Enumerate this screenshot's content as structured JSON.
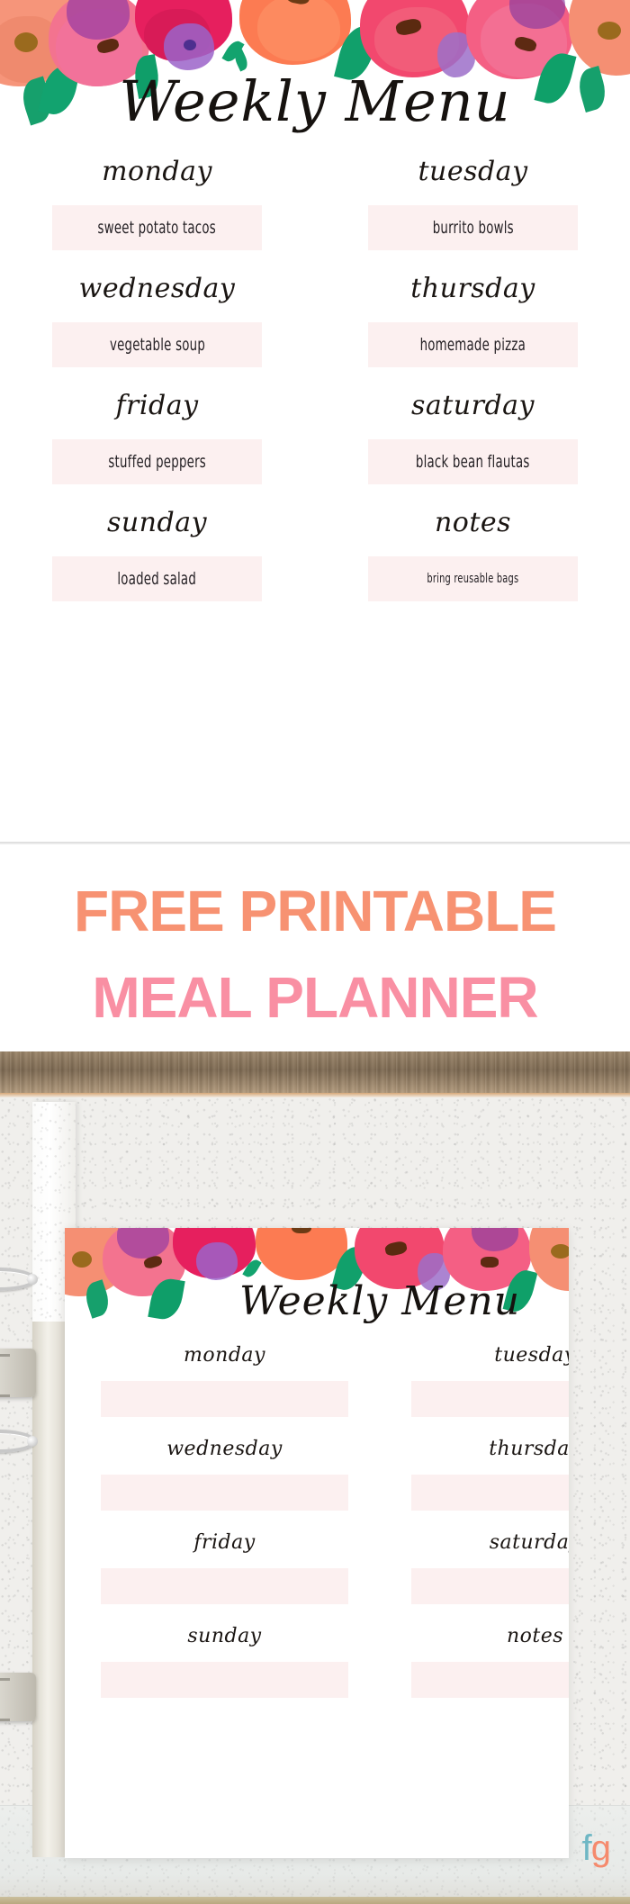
{
  "printable": {
    "title": "Weekly Menu",
    "cells": [
      {
        "day": "monday",
        "meal": "sweet potato tacos"
      },
      {
        "day": "tuesday",
        "meal": "burrito bowls"
      },
      {
        "day": "wednesday",
        "meal": "vegetable soup"
      },
      {
        "day": "thursday",
        "meal": "homemade pizza"
      },
      {
        "day": "friday",
        "meal": "stuffed peppers"
      },
      {
        "day": "saturday",
        "meal": "black bean flautas"
      },
      {
        "day": "sunday",
        "meal": "loaded salad"
      },
      {
        "day": "notes",
        "meal": "bring reusable bags"
      }
    ]
  },
  "promo": {
    "line1": "FREE PRINTABLE",
    "line2": "MEAL PLANNER",
    "line1_color": "#f79272",
    "line2_color": "#f98fa3"
  },
  "photo": {
    "title": "Weekly Menu",
    "cells": [
      {
        "day": "monday",
        "meal": ""
      },
      {
        "day": "tuesday",
        "meal": ""
      },
      {
        "day": "wednesday",
        "meal": ""
      },
      {
        "day": "thursday",
        "meal": ""
      },
      {
        "day": "friday",
        "meal": ""
      },
      {
        "day": "saturday",
        "meal": ""
      },
      {
        "day": "sunday",
        "meal": ""
      },
      {
        "day": "notes",
        "meal": ""
      }
    ]
  },
  "logo": {
    "f": "f",
    "g": "g"
  },
  "colors": {
    "meal_bar": "#fcf0f0",
    "coral": "#f79272",
    "pink": "#f98fa3",
    "ink": "#1a1512"
  }
}
